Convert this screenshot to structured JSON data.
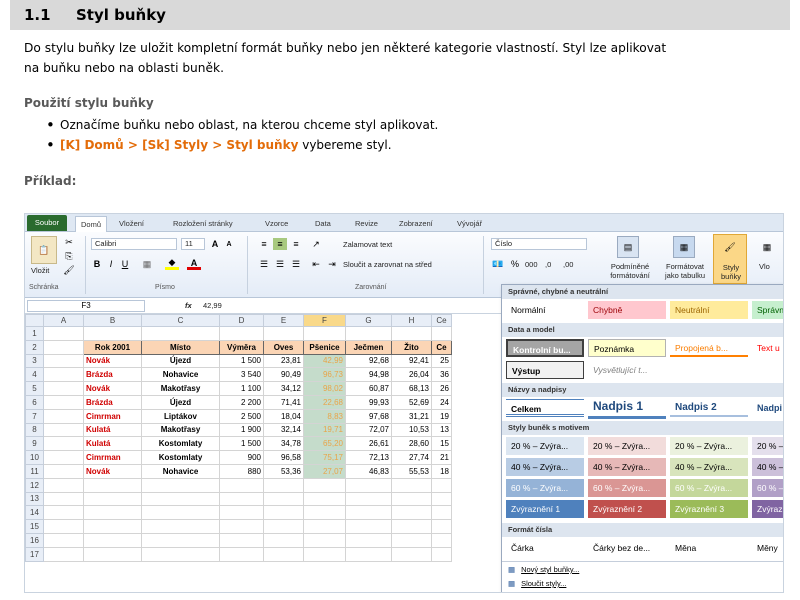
{
  "heading": {
    "number": "1.1",
    "title": "Styl buňky"
  },
  "intro": [
    "Do stylu buňky lze uložit kompletní formát buňky nebo jen některé kategorie vlastností. Styl lze aplikovat",
    "na buňku nebo na oblasti buněk."
  ],
  "usage": {
    "title": "Použití stylu buňky",
    "bullet1": "Označíme buňku nebo oblast, na kterou chceme styl aplikovat.",
    "bullet2_path": "[K] Domů > [Sk] Styly > Styl buňky",
    "bullet2_rest": " vybereme styl."
  },
  "example_label": "Příklad:",
  "excel": {
    "tabs": [
      "Soubor",
      "Domů",
      "Vložení",
      "Rozložení stránky",
      "Vzorce",
      "Data",
      "Revize",
      "Zobrazení",
      "Vývojář"
    ],
    "ribbon": {
      "paste": "Vložit",
      "font_name": "Calibri",
      "font_size": "11",
      "wrap": "Zalamovat text",
      "merge": "Sloučit a zarovnat na střed",
      "number_format": "Číslo",
      "cond_format": [
        "Podmíněné",
        "formátování"
      ],
      "format_table": [
        "Formátovat",
        "jako tabulku"
      ],
      "cell_styles": [
        "Styly",
        "buňky"
      ],
      "insert": "Vlo",
      "groups": [
        "Schránka",
        "Písmo",
        "Zarovnání"
      ]
    },
    "name_box": "F3",
    "formula": "42,99",
    "columns": [
      "A",
      "B",
      "C",
      "D",
      "E",
      "F",
      "G",
      "H",
      "Ce"
    ],
    "header_row": [
      "Rok 2001",
      "Místo",
      "Výměra",
      "Oves",
      "Pšenice",
      "Ječmen",
      "Žito",
      "Ce"
    ],
    "rows": [
      [
        "Novák",
        "Újezd",
        "1 500",
        "23,81",
        "42,99",
        "92,68",
        "92,41",
        "25"
      ],
      [
        "Brázda",
        "Nohavice",
        "3 540",
        "90,49",
        "96,73",
        "94,98",
        "26,04",
        "36"
      ],
      [
        "Novák",
        "Makotřasy",
        "1 100",
        "34,12",
        "98,02",
        "60,87",
        "68,13",
        "26"
      ],
      [
        "Brázda",
        "Újezd",
        "2 200",
        "71,41",
        "22,68",
        "99,93",
        "52,69",
        "24"
      ],
      [
        "Cimrman",
        "Liptákov",
        "2 500",
        "18,04",
        "8,83",
        "97,68",
        "31,21",
        "19"
      ],
      [
        "Kulatá",
        "Makotřasy",
        "1 900",
        "32,14",
        "19,71",
        "72,07",
        "10,53",
        "13"
      ],
      [
        "Kulatá",
        "Kostomlaty",
        "1 500",
        "34,78",
        "65,20",
        "26,61",
        "28,60",
        "15"
      ],
      [
        "Cimrman",
        "Kostomlaty",
        "900",
        "96,58",
        "75,17",
        "72,13",
        "27,74",
        "21"
      ],
      [
        "Novák",
        "Nohavice",
        "880",
        "53,36",
        "27,07",
        "46,83",
        "55,53",
        "18"
      ]
    ],
    "row_numbers": [
      "1",
      "2",
      "3",
      "4",
      "5",
      "6",
      "7",
      "8",
      "9",
      "10",
      "11",
      "12",
      "13",
      "14",
      "15",
      "16",
      "17"
    ],
    "gallery": {
      "sec1": "Správné, chybné a neutrální",
      "s1": [
        "Normální",
        "Chybně",
        "Neutrální",
        "Správn"
      ],
      "sec2": "Data a model",
      "s2a": [
        "Kontrolní bu...",
        "Poznámka",
        "Propojená b...",
        "Text u"
      ],
      "s2b": [
        "Výstup",
        "Vysvětlující t..."
      ],
      "sec3": "Názvy a nadpisy",
      "s3": [
        "Celkem",
        "Nadpis 1",
        "Nadpis 2",
        "Nadpi"
      ],
      "sec4": "Styly buněk s motivem",
      "t20": [
        "20 % – Zvýra...",
        "20 % – Zvýra...",
        "20 % – Zvýra...",
        "20 % –"
      ],
      "t40": [
        "40 % – Zvýra...",
        "40 % – Zvýra...",
        "40 % – Zvýra...",
        "40 % –"
      ],
      "t60": [
        "60 % – Zvýra...",
        "60 % – Zvýra...",
        "60 % – Zvýra...",
        "60 % –"
      ],
      "tz": [
        "Zvýraznění 1",
        "Zvýraznění 2",
        "Zvýraznění 3",
        "Zvýraz"
      ],
      "sec5": "Formát čísla",
      "s5": [
        "Čárka",
        "Čárky bez de...",
        "Měna",
        "Měny"
      ],
      "new_style": "Nový styl buňky...",
      "merge_styles": "Sloučit styly..."
    }
  }
}
